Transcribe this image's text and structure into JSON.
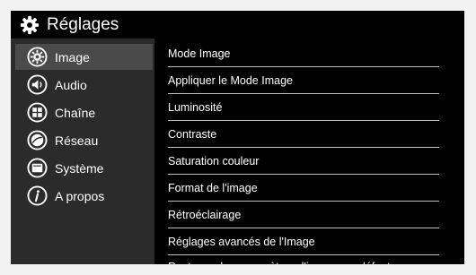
{
  "header": {
    "title": "Réglages",
    "icon": "gear-icon"
  },
  "sidebar": {
    "items": [
      {
        "label": "Image",
        "icon": "picture-settings-icon",
        "selected": true
      },
      {
        "label": "Audio",
        "icon": "speaker-icon"
      },
      {
        "label": "Chaîne",
        "icon": "grid-channel-icon"
      },
      {
        "label": "Réseau",
        "icon": "globe-icon"
      },
      {
        "label": "Système",
        "icon": "system-screen-icon"
      },
      {
        "label": "A propos",
        "icon": "info-icon"
      }
    ]
  },
  "options": [
    {
      "label": "Mode Image"
    },
    {
      "label": "Appliquer le Mode Image"
    },
    {
      "label": "Luminosité"
    },
    {
      "label": "Contraste"
    },
    {
      "label": "Saturation couleur"
    },
    {
      "label": "Format de l'image"
    },
    {
      "label": "Rétroéclairage"
    },
    {
      "label": "Réglages avancés de l'Image"
    },
    {
      "label": "Restaurer les paramètres d'image par défaut"
    }
  ]
}
